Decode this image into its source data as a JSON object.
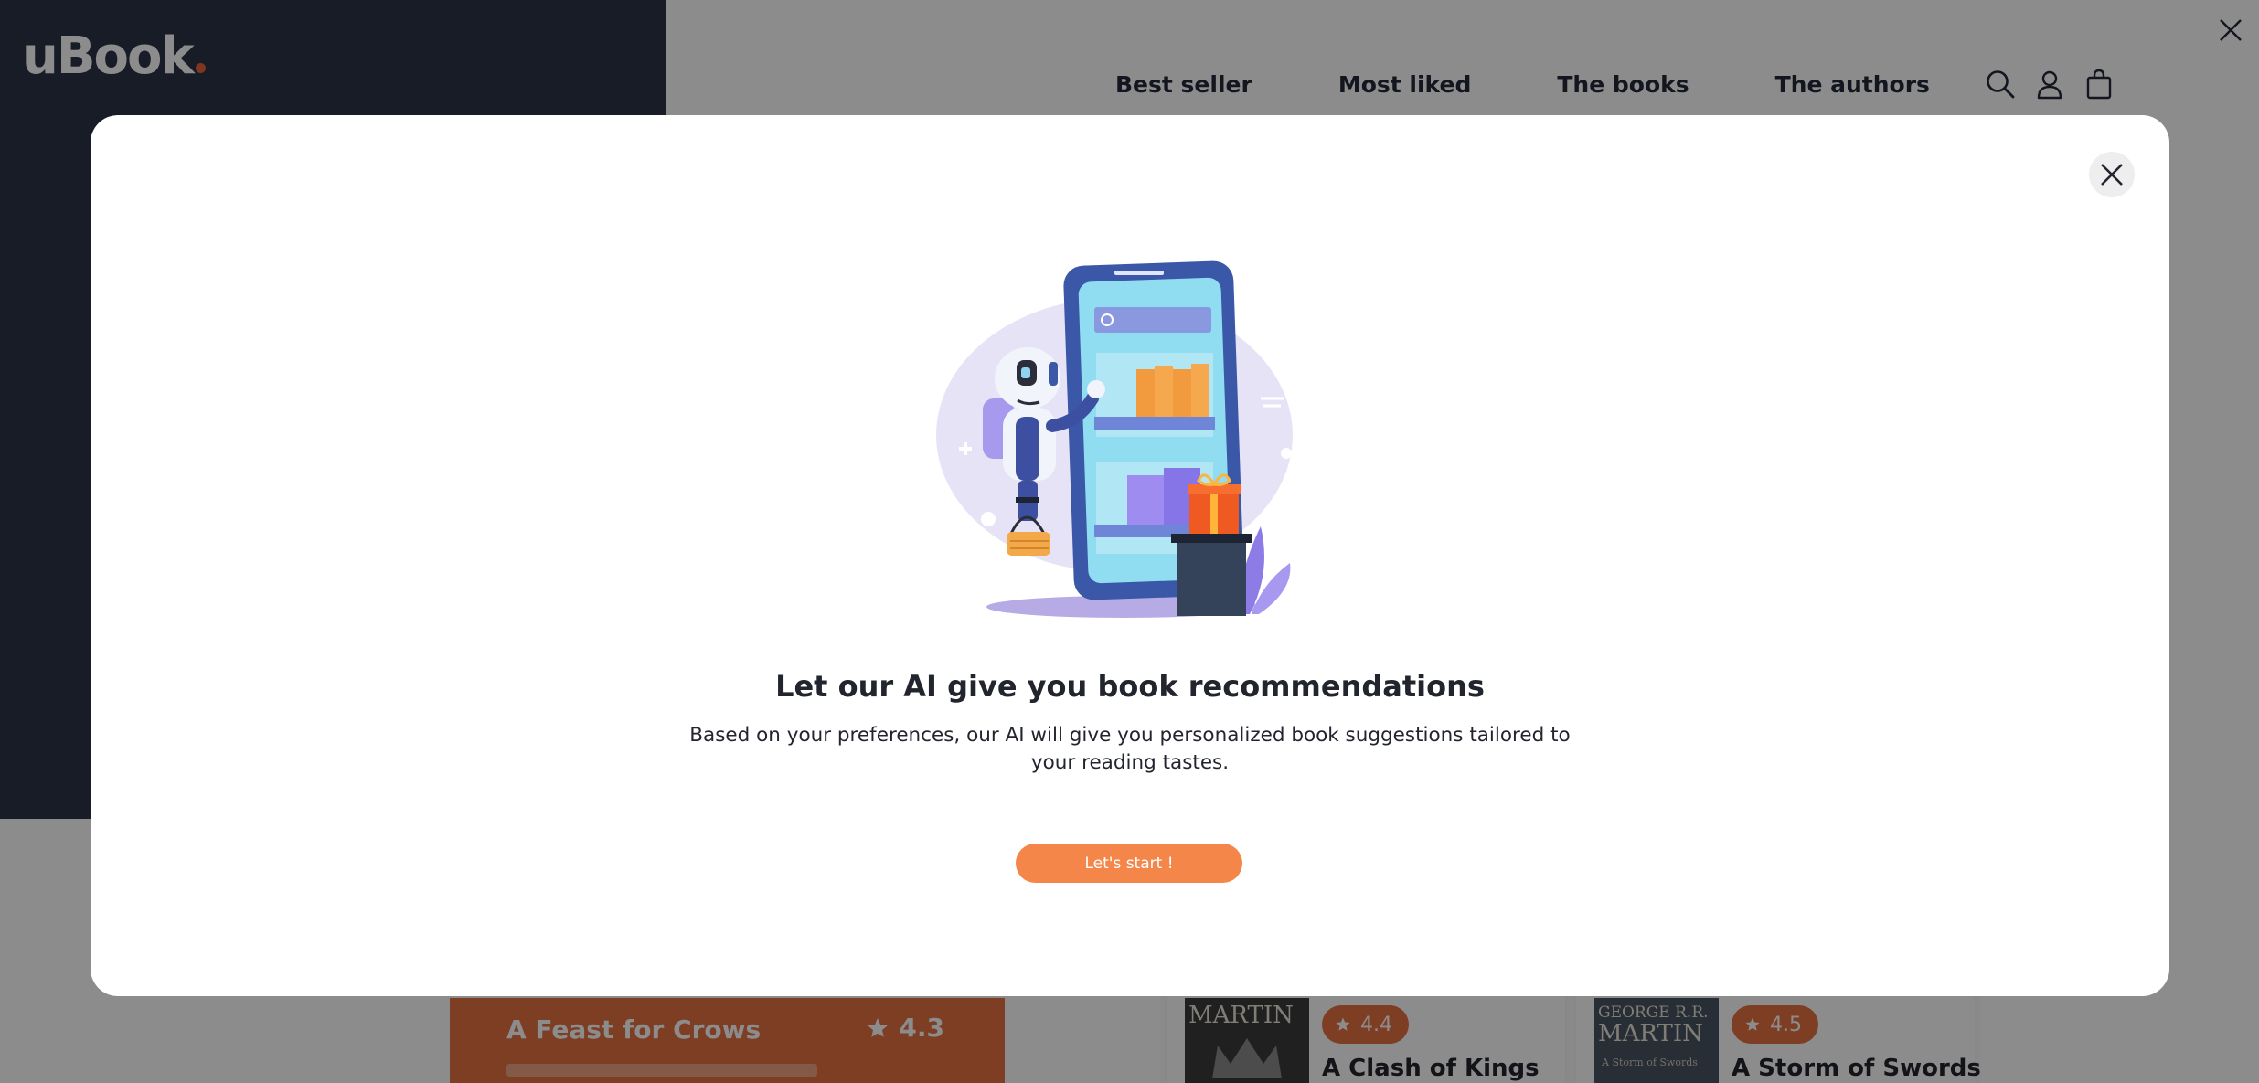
{
  "brand": {
    "logo": "uBook",
    "accent": "#e8623a"
  },
  "nav": {
    "items": [
      "Best seller",
      "Most liked",
      "The books",
      "The authors"
    ]
  },
  "header_icons": [
    "search-icon",
    "user-icon",
    "cart-icon"
  ],
  "featured": {
    "title": "A Feast for Crows",
    "rating": "4.3"
  },
  "books": [
    {
      "cover_author": "MARTIN",
      "cover_sub": "",
      "rating": "4.4",
      "title": "A Clash of Kings"
    },
    {
      "cover_author": "MARTIN",
      "cover_sub": "A Storm of Swords",
      "cover_top": "GEORGE R.R.",
      "rating": "4.5",
      "title": "A Storm of Swords"
    }
  ],
  "modal": {
    "title": "Let our AI give you book recommendations",
    "description": "Based on your preferences, our AI will give you personalized book suggestions tailored to your reading tastes.",
    "button": "Let's start !"
  },
  "colors": {
    "dark_panel": "#2b3447",
    "orange": "#f58649",
    "card_orange": "#e67142"
  }
}
